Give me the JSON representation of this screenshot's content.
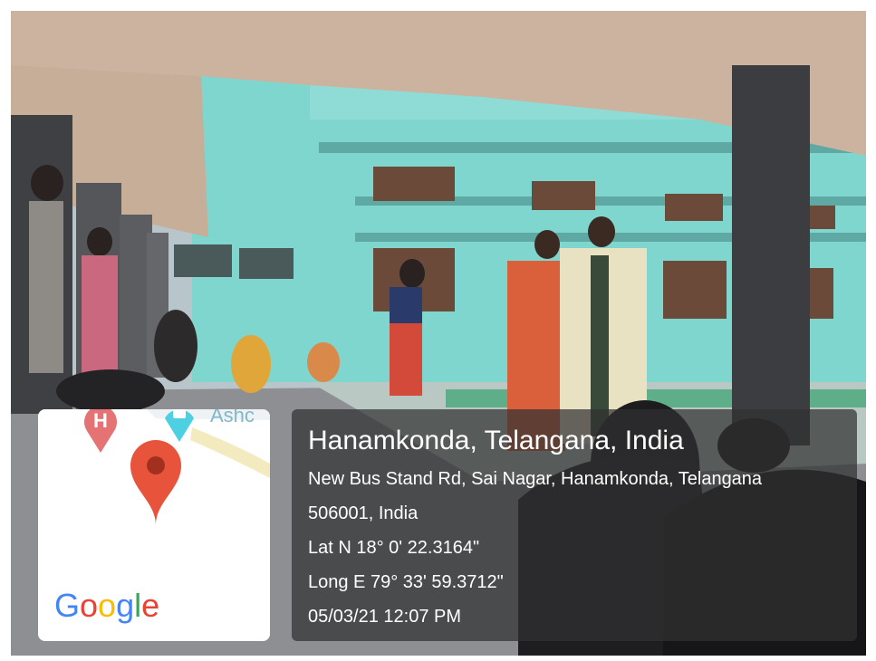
{
  "photo": {
    "scene_description_icon": "campus-photo",
    "colors": {
      "building": "#7fd6cf",
      "ceiling": "#cbb39f",
      "pillar": "#3c3d41",
      "floor": "#8d8f92"
    }
  },
  "map": {
    "partial_label": "Ashc",
    "hospital_marker_letter": "H",
    "google_logo": [
      "G",
      "o",
      "o",
      "g",
      "l",
      "e"
    ],
    "google_colors": [
      "#4285F4",
      "#EA4335",
      "#FBBC05",
      "#4285F4",
      "#34A853",
      "#EA4335"
    ]
  },
  "location": {
    "title": "Hanamkonda, Telangana, India",
    "address_line1": "New Bus Stand Rd, Sai Nagar, Hanamkonda, Telangana",
    "address_line2": "506001, India",
    "latitude": "Lat N 18° 0' 22.3164\"",
    "longitude": "Long E 79° 33' 59.3712\"",
    "timestamp": "05/03/21 12:07 PM"
  }
}
